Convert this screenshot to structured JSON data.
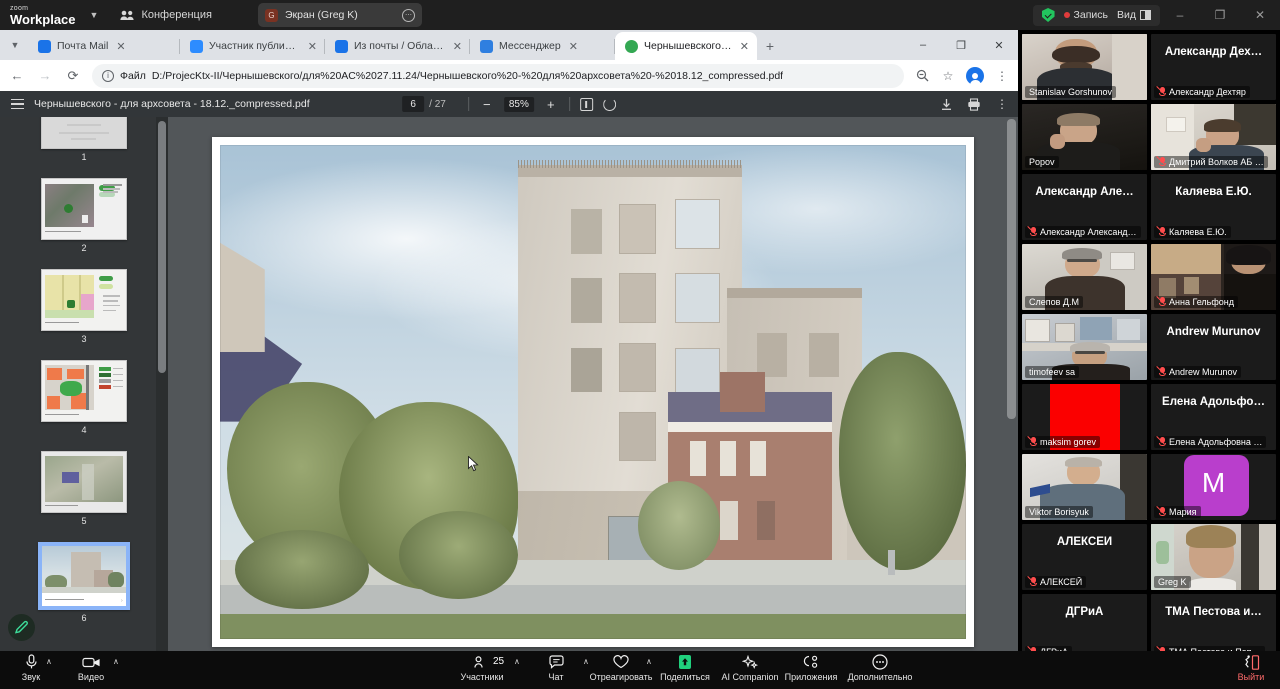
{
  "zoom_topbar": {
    "logo_small": "zoom",
    "logo_main": "Workplace",
    "conference_label": "Конференция",
    "screen_share_chip": {
      "initial": "G",
      "label": "Экран (Greg K)"
    },
    "recording_label": "Запись",
    "view_label": "Вид",
    "window_minimize": "–",
    "window_maximize": "❐",
    "window_close": "✕"
  },
  "browser": {
    "tabs": [
      {
        "title": "Почта Mail",
        "active": false,
        "favicon": "#1a73e8"
      },
      {
        "title": "Участник публикации – Zoom",
        "active": false,
        "favicon": "#2d8cff"
      },
      {
        "title": "Из почты / Облако Mail",
        "active": false,
        "favicon": "#1a73e8"
      },
      {
        "title": "Мессенджер",
        "active": false,
        "favicon": "#2f7fe0"
      },
      {
        "title": "Чернышевского - для архсо",
        "active": true,
        "favicon": "#34a853"
      }
    ],
    "new_tab_label": "+",
    "close_label": "✕",
    "window_minimize": "–",
    "window_maximize": "❐",
    "window_close": "✕",
    "back_label": "←",
    "forward_label": "→",
    "reload_label": "⟳",
    "url_scheme": "Файл",
    "url": "D:/ProjecKtx-II/Чернышевского/для%20AC%2027.11.24/Чернышевского%20-%20для%20архсовета%20-%2018.12_compressed.pdf",
    "zoom_icon": "search-minus",
    "star_icon": "☆",
    "menu_icon": "⋮"
  },
  "pdf_viewer": {
    "title": "Чернышевского - для архсовета - 18.12._compressed.pdf",
    "current_page": "6",
    "total_pages": "/ 27",
    "zoom_out": "−",
    "zoom_level": "85%",
    "zoom_in": "+",
    "fit_icon": "fit-page-icon",
    "rotate_icon": "rotate-icon",
    "download_icon": "download-icon",
    "print_icon": "print-icon",
    "more_icon": "⋮",
    "thumbnails": [
      {
        "num": "1",
        "kind": "title"
      },
      {
        "num": "2",
        "kind": "aerial"
      },
      {
        "num": "3",
        "kind": "plan-yellow"
      },
      {
        "num": "4",
        "kind": "plan-color"
      },
      {
        "num": "5",
        "kind": "site-photo"
      },
      {
        "num": "6",
        "kind": "render",
        "selected": true
      }
    ],
    "page_caption": ""
  },
  "gallery": {
    "participants": [
      {
        "name": "Stanislav Gorshunov",
        "type": "video",
        "muted": false,
        "bigname": ""
      },
      {
        "name": "Александр Дехтяр",
        "type": "name",
        "muted": true,
        "bigname": "Александр  Дех…"
      },
      {
        "name": "Popov",
        "type": "video",
        "muted": false,
        "bigname": ""
      },
      {
        "name": "Дмитрий Волков АБ …",
        "type": "video",
        "muted": true,
        "bigname": ""
      },
      {
        "name": "Александр Александ…",
        "type": "name",
        "muted": true,
        "bigname": "Александр  Але…"
      },
      {
        "name": "Каляева Е.Ю.",
        "type": "name",
        "muted": true,
        "bigname": "Каляева Е.Ю."
      },
      {
        "name": "Слепов Д.М",
        "type": "video",
        "muted": false,
        "bigname": ""
      },
      {
        "name": "Анна Гельфонд",
        "type": "video",
        "muted": true,
        "bigname": ""
      },
      {
        "name": "timofeev sa",
        "type": "video",
        "muted": false,
        "bigname": ""
      },
      {
        "name": "Andrew Murunov",
        "type": "name",
        "muted": true,
        "bigname": "Andrew Murunov"
      },
      {
        "name": "maksim gorev",
        "type": "color",
        "muted": true,
        "bigname": "",
        "color": "#fb0000"
      },
      {
        "name": "Елена Адольфовна …",
        "type": "name",
        "muted": true,
        "bigname": "Елена  Адольфо…"
      },
      {
        "name": "Viktor Borisyuk",
        "type": "video",
        "muted": false,
        "bigname": ""
      },
      {
        "name": "Мария",
        "type": "initial",
        "muted": true,
        "bigname": "",
        "color": "#b93ecc",
        "initial": "M"
      },
      {
        "name": "АЛЕКСЕЙ",
        "type": "name",
        "muted": true,
        "bigname": "АЛЕКСЕЙ"
      },
      {
        "name": "Greg K",
        "type": "video",
        "muted": false,
        "bigname": "",
        "speaking": true
      },
      {
        "name": "ДГРиА",
        "type": "name",
        "muted": true,
        "bigname": "ДГРиА"
      },
      {
        "name": "ТМА Пестова и Поп…",
        "type": "name",
        "muted": true,
        "bigname": "ТМА Пестова и…"
      }
    ],
    "scroll_caret": "∨"
  },
  "bottom_bar": {
    "audio_label": "Звук",
    "video_label": "Видео",
    "participants_label": "Участники",
    "participants_count": "25",
    "chat_label": "Чат",
    "react_label": "Отреагировать",
    "share_label": "Поделиться",
    "ai_label": "AI Companion",
    "apps_label": "Приложения",
    "more_label": "Дополнительно",
    "leave_label": "Выйти",
    "caret": "∧"
  }
}
